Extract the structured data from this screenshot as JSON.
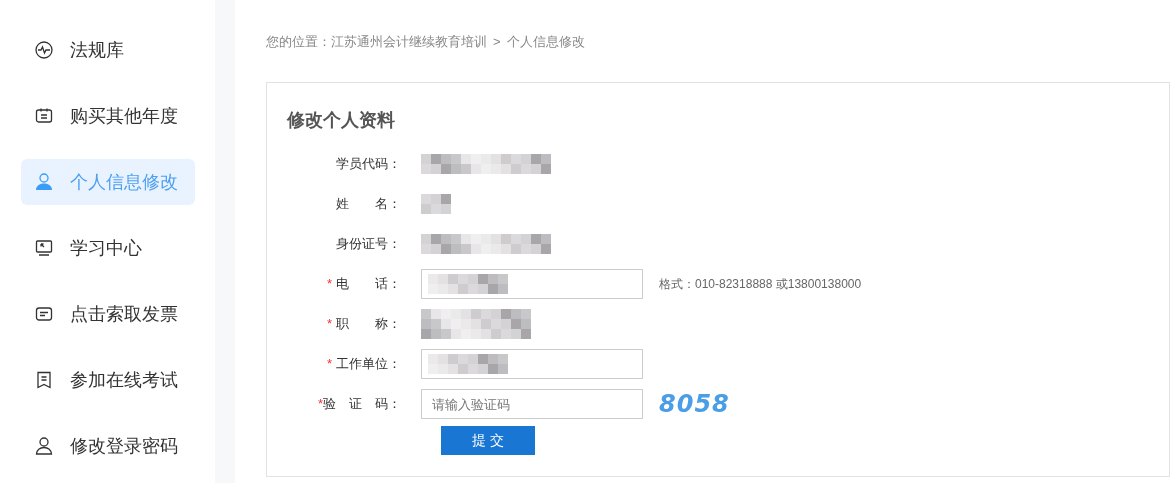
{
  "sidebar": {
    "items": [
      {
        "label": "法规库",
        "selected": false
      },
      {
        "label": "购买其他年度",
        "selected": false
      },
      {
        "label": "个人信息修改",
        "selected": true
      },
      {
        "label": "学习中心",
        "selected": false
      },
      {
        "label": "点击索取发票",
        "selected": false
      },
      {
        "label": "参加在线考试",
        "selected": false
      },
      {
        "label": "修改登录密码",
        "selected": false
      }
    ]
  },
  "breadcrumb": {
    "prefix": "您的位置：",
    "items": [
      "江苏通州会计继续教育培训",
      "个人信息修改"
    ],
    "separator": ">"
  },
  "form": {
    "title": "修改个人资料",
    "required_mark": "*",
    "rows": [
      {
        "label": "学员代码：",
        "required": false,
        "kind": "blurred_text"
      },
      {
        "label": "姓　　名：",
        "required": false,
        "kind": "blurred_short"
      },
      {
        "label": "身份证号：",
        "required": false,
        "kind": "blurred_text"
      },
      {
        "label": "电　　话：",
        "required": true,
        "kind": "blurred_input",
        "hint": "格式：010-82318888 或13800138000"
      },
      {
        "label": "职　　称：",
        "required": true,
        "kind": "blurred_select"
      },
      {
        "label": "工作单位：",
        "required": true,
        "kind": "blurred_input"
      },
      {
        "label": "验　证　码：",
        "required": true,
        "kind": "captcha",
        "placeholder": "请输入验证码",
        "captcha": "8058"
      }
    ],
    "submit": "提 交"
  }
}
